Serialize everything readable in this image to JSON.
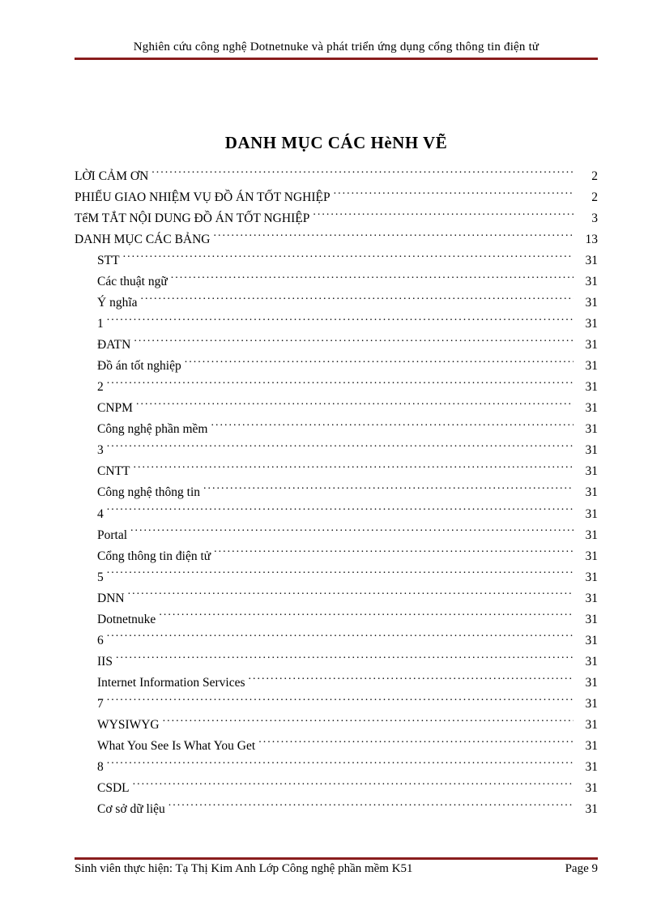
{
  "header": "Nghiên cứu công nghệ Dotnetnuke và phát triển ứng dụng cổng thông tin điện tử",
  "title": "DANH MỤC CÁC HèNH VẼ",
  "toc": [
    {
      "level": "top",
      "title": "LỜI CẢM ƠN",
      "page": "2"
    },
    {
      "level": "top",
      "title": "PHIẾU GIAO NHIỆM VỤ ĐỒ ÁN TỐT NGHIỆP",
      "page": "2"
    },
    {
      "level": "top",
      "title": "TểM TẮT NỘI DUNG ĐỒ ÁN TỐT NGHIỆP",
      "page": "3"
    },
    {
      "level": "top",
      "title": "DANH MỤC CÁC BẢNG",
      "page": "13"
    },
    {
      "level": "sub",
      "title": "STT",
      "page": "31"
    },
    {
      "level": "sub",
      "title": "Các thuật ngữ",
      "page": "31"
    },
    {
      "level": "sub",
      "title": "Ý nghĩa",
      "page": "31"
    },
    {
      "level": "sub",
      "title": "1",
      "page": "31"
    },
    {
      "level": "sub",
      "title": "ĐATN",
      "page": "31"
    },
    {
      "level": "sub",
      "title": "Đồ án tốt nghiệp",
      "page": "31"
    },
    {
      "level": "sub",
      "title": "2",
      "page": "31"
    },
    {
      "level": "sub",
      "title": "CNPM",
      "page": "31"
    },
    {
      "level": "sub",
      "title": "Công nghệ phần mềm",
      "page": "31"
    },
    {
      "level": "sub",
      "title": "3",
      "page": "31"
    },
    {
      "level": "sub",
      "title": "CNTT",
      "page": "31"
    },
    {
      "level": "sub",
      "title": "Công nghệ thông tin",
      "page": "31"
    },
    {
      "level": "sub",
      "title": "4",
      "page": "31"
    },
    {
      "level": "sub",
      "title": "Portal",
      "page": "31"
    },
    {
      "level": "sub",
      "title": "Cổng thông tin điện tử",
      "page": "31"
    },
    {
      "level": "sub",
      "title": "5",
      "page": "31"
    },
    {
      "level": "sub",
      "title": "DNN",
      "page": "31"
    },
    {
      "level": "sub",
      "title": "Dotnetnuke",
      "page": "31"
    },
    {
      "level": "sub",
      "title": "6",
      "page": "31"
    },
    {
      "level": "sub",
      "title": "IIS",
      "page": "31"
    },
    {
      "level": "sub",
      "title": "Internet Information Services",
      "page": "31"
    },
    {
      "level": "sub",
      "title": "7",
      "page": "31"
    },
    {
      "level": "sub",
      "title": "WYSIWYG",
      "page": "31"
    },
    {
      "level": "sub",
      "title": "What You See Is What You Get",
      "page": "31"
    },
    {
      "level": "sub",
      "title": "8",
      "page": "31"
    },
    {
      "level": "sub",
      "title": "CSDL",
      "page": "31"
    },
    {
      "level": "sub",
      "title": "Cơ sở dữ liệu",
      "page": "31"
    }
  ],
  "footer": {
    "left": "Sinh viên thực hiện: Tạ Thị Kim Anh Lớp Công nghệ phần mềm K51",
    "right": "Page 9"
  }
}
